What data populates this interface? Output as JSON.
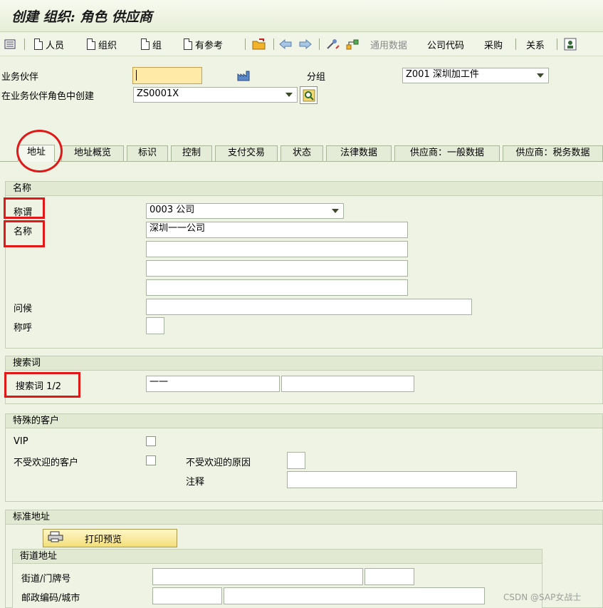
{
  "title": "创建 组织: 角色 供应商",
  "toolbar": {
    "person": "人员",
    "org": "组织",
    "group": "组",
    "with_ref": "有参考",
    "general_data": "通用数据",
    "company_code": "公司代码",
    "purchasing": "采购",
    "relations": "关系"
  },
  "header": {
    "bp_label": "业务伙伴",
    "bp_value": "",
    "group_label": "分组",
    "group_value": "Z001 深圳加工件",
    "role_label": "在业务伙伴角色中创建",
    "role_value": "ZS0001X"
  },
  "tabs": [
    "地址",
    "地址概览",
    "标识",
    "控制",
    "支付交易",
    "状态",
    "法律数据",
    "供应商：一般数据",
    "供应商：税务数据"
  ],
  "name_section": {
    "title": "名称",
    "form_of_address_label": "称谓",
    "form_of_address_value": "0003 公司",
    "name_label": "名称",
    "name1": "深圳一一公司",
    "name2": "",
    "name3": "",
    "name4": "",
    "greeting_label": "问候",
    "greeting_value": "",
    "salutation_label": "称呼",
    "salutation_value": ""
  },
  "search_section": {
    "title": "搜索词",
    "label": "搜索词 1/2",
    "term1": "一一",
    "term2": ""
  },
  "special_section": {
    "title": "特殊的客户",
    "vip_label": "VIP",
    "unwanted_label": "不受欢迎的客户",
    "unwanted_reason_label": "不受欢迎的原因",
    "unwanted_reason_value": "",
    "note_label": "注释",
    "note_value": ""
  },
  "std_address": {
    "title": "标准地址",
    "print_preview": "打印预览",
    "street_title": "街道地址",
    "street_label": "街道/门牌号",
    "street_value": "",
    "house_no": "",
    "postal_label": "邮政编码/城市",
    "postal_value": "",
    "city_value": ""
  },
  "watermark": "CSDN @SAP女战士",
  "colors": {
    "annotation_red": "#e01818",
    "required_field": "#ffeaa8"
  }
}
